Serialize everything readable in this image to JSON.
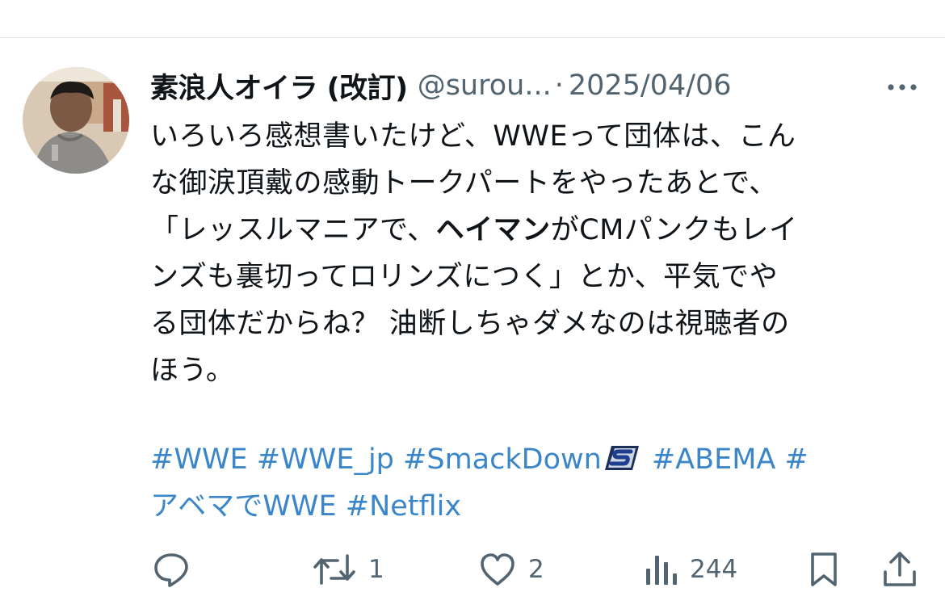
{
  "tweet": {
    "author_name": "素浪人オイラ (改訂)",
    "handle": "@surou...",
    "separator": "·",
    "date": "2025/04/06",
    "body_lines": [
      "いろいろ感想書いたけど、WWEって団体は、こん",
      "な御涙頂戴の感動トークパートをやったあとで、"
    ],
    "line3_pre": "「レッスルマニアで、",
    "line3_bold": "ヘイマン",
    "line3_post": "がCMパンクもレイ",
    "body_tail": [
      "ンズも裏切ってロリンズにつく」とか、平気でや",
      "る団体だからね？ 油断しちゃダメなのは視聴者の",
      "ほう。"
    ],
    "hashtags_line1": [
      "#WWE",
      "#WWE_jp",
      "#SmackDown",
      "#ABEMA",
      "#"
    ],
    "hashtags_line2": [
      "アベマでWWE",
      "#Netflix"
    ]
  },
  "actions": {
    "reply": {
      "icon": "reply-icon",
      "count": ""
    },
    "retweet": {
      "icon": "retweet-icon",
      "count": "1"
    },
    "like": {
      "icon": "heart-icon",
      "count": "2"
    },
    "views": {
      "icon": "views-icon",
      "count": "244"
    },
    "bookmark": {
      "icon": "bookmark-icon"
    },
    "share": {
      "icon": "share-icon"
    }
  },
  "colors": {
    "text": "#0f1419",
    "secondary": "#536471",
    "link": "#3a86c9",
    "divider": "#e6e9ec"
  }
}
